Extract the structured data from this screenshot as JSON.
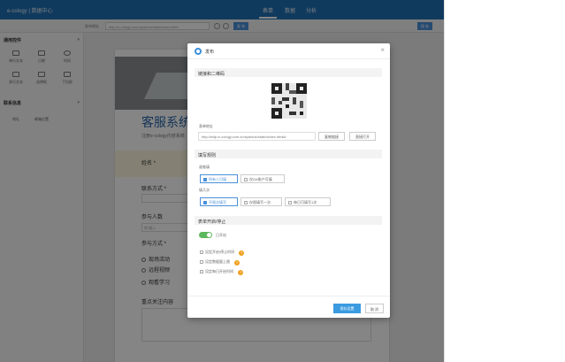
{
  "topbar": {
    "brand": "e-cology | 数据中心",
    "tabs": [
      "表单",
      "数据",
      "分析"
    ],
    "active_tab": "表单",
    "bg_color": "#1f6fb3"
  },
  "address": {
    "label": "发布地址",
    "url": "http://e-cology.com/spa/edc/static/index.html",
    "publish_label": "发 布",
    "save_label": "保 存"
  },
  "sidebar": {
    "section1": "通用控件",
    "section1_items": [
      "单行文本",
      "日期",
      "时间",
      "多行文本",
      "选择框",
      "下拉框"
    ],
    "section2": "联系信息",
    "section2_items": [
      "地址",
      "邮箱位置"
    ]
  },
  "canvas": {
    "title": "客服系统",
    "subtitle": "注册e-cology内容系统",
    "field_name": "姓名 *",
    "field_contact": "联系方式 *",
    "field_count": "参与人数",
    "count_placeholder": "例:输入",
    "field_method": "参与方式 *",
    "radio_options": [
      "现场活动",
      "远程视频",
      "观看学习"
    ],
    "field_focus": "重点关注内容"
  },
  "modal": {
    "title": "发布",
    "section_link": "链接和二维码",
    "url_label": "表单地址",
    "url_value": "http://edlp.e-cology.com.cn/spa/edc/static/index.html#/",
    "copy_label": "复制链接",
    "open_label": "直接打开",
    "section_rules": "填写规则",
    "who_label": "谁能填",
    "who_options": [
      "所有人可填",
      "仅OA账户可填"
    ],
    "times_label": "填几次",
    "times_options": [
      "不限次填写",
      "仅限填写一次",
      "每日可填写1次"
    ],
    "section_open": "表单开启/停止",
    "toggle_label": "已开启",
    "check_options": [
      "设定开启/停止时间",
      "设定数据量上限",
      "设定每日开启时间"
    ],
    "help_glyph": "?",
    "confirm_label": "保存设置",
    "cancel_label": "取 消",
    "close_glyph": "×",
    "accent_color": "#3a9be0"
  }
}
